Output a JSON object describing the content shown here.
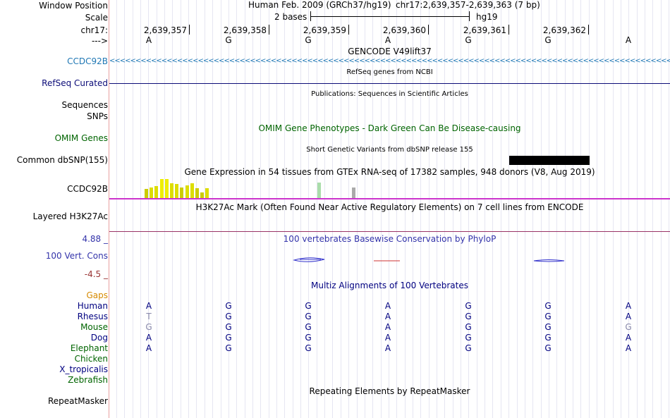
{
  "labels": {
    "window_position": "Window Position",
    "scale": "Scale",
    "chrom": "chr17:",
    "strand": "--->",
    "ccdc92b_gencode": "CCDC92B",
    "refseq": "RefSeq Curated",
    "sequences": "Sequences",
    "snps": "SNPs",
    "omim": "OMIM Genes",
    "dbsnp": "Common dbSNP(155)",
    "gtex": "CCDC92B",
    "h3k27ac": "Layered H3K27Ac",
    "cons_max": "4.88 _",
    "cons_name": "100 Vert. Cons",
    "cons_min": "-4.5 _",
    "gaps": "Gaps",
    "repeatmasker": "RepeatMasker"
  },
  "header": {
    "assembly": "Human Feb. 2009 (GRCh37/hg19)",
    "position": "chr17:2,639,357-2,639,363 (7 bp)",
    "scale_text": "2 bases",
    "scale_db": "hg19"
  },
  "ruler": {
    "positions": [
      "2,639,357",
      "2,639,358",
      "2,639,359",
      "2,639,360",
      "2,639,361",
      "2,639,362"
    ],
    "bases": [
      "A",
      "G",
      "G",
      "A",
      "G",
      "G",
      "A"
    ]
  },
  "track_titles": {
    "gencode": "GENCODE V49lift37",
    "refseq": "RefSeq genes from NCBI",
    "publications": "Publications: Sequences in Scientific Articles",
    "omim": "OMIM Gene Phenotypes - Dark Green Can Be Disease-causing",
    "dbsnp": "Short Genetic Variants from dbSNP release 155",
    "gtex": "Gene Expression in 54 tissues from GTEx RNA-seq of 17382 samples, 948 donors (V8, Aug 2019)",
    "h3k27ac": "H3K27Ac Mark (Often Found Near Active Regulatory Elements) on 7 cell lines from ENCODE",
    "conservation": "100 vertebrates Basewise Conservation by PhyloP",
    "multiz": "Multiz Alignments of 100 Vertebrates",
    "repeatmasker": "Repeating Elements by RepeatMasker"
  },
  "gtex_bars": {
    "values": [
      0.45,
      0.55,
      0.6,
      0.95,
      0.95,
      0.75,
      0.7,
      0.55,
      0.65,
      0.75,
      0.5,
      0.3,
      0.5
    ],
    "colors": [
      "#cccc00",
      "#dddd00",
      "#dddd00",
      "#eeee00",
      "#eeee00",
      "#dddd00",
      "#dddd00",
      "#cccc00",
      "#dddd00",
      "#dddd00",
      "#cccc00",
      "#cccc00",
      "#dddd00"
    ],
    "extra": [
      {
        "value": 0.8,
        "color": "#aaddaa"
      },
      {
        "value": 0.55,
        "color": "#aaaaaa"
      }
    ]
  },
  "multiz": {
    "species": [
      {
        "name": "Human",
        "color": "#000080",
        "bases": [
          "A",
          "G",
          "G",
          "A",
          "G",
          "G",
          "A"
        ],
        "faded": [
          false,
          false,
          false,
          false,
          false,
          false,
          false
        ]
      },
      {
        "name": "Rhesus",
        "color": "#000080",
        "bases": [
          "T",
          "G",
          "G",
          "A",
          "G",
          "G",
          "A"
        ],
        "faded": [
          true,
          false,
          false,
          false,
          false,
          false,
          false
        ]
      },
      {
        "name": "Mouse",
        "color": "#006400",
        "bases": [
          "G",
          "G",
          "G",
          "A",
          "G",
          "G",
          "G"
        ],
        "faded": [
          true,
          false,
          false,
          false,
          false,
          false,
          true
        ]
      },
      {
        "name": "Dog",
        "color": "#000080",
        "bases": [
          "A",
          "G",
          "G",
          "A",
          "G",
          "G",
          "A"
        ],
        "faded": [
          false,
          false,
          false,
          false,
          false,
          false,
          false
        ]
      },
      {
        "name": "Elephant",
        "color": "#006400",
        "bases": [
          "A",
          "G",
          "G",
          "A",
          "G",
          "G",
          "A"
        ],
        "faded": [
          false,
          false,
          false,
          false,
          false,
          false,
          false
        ]
      },
      {
        "name": "Chicken",
        "color": "#006400",
        "bases": [],
        "faded": []
      },
      {
        "name": "X_tropicalis",
        "color": "#000080",
        "bases": [],
        "faded": []
      },
      {
        "name": "Zebrafish",
        "color": "#006400",
        "bases": [],
        "faded": []
      }
    ]
  },
  "colors": {
    "gencode": "#1f77b4",
    "refseq": "#0c0c78",
    "omim": "#006400",
    "conservation": "#3333aa",
    "cons_neg": "#993333",
    "gaps": "#d68a00",
    "gtex_line": "#cc33cc",
    "h3k27ac_line": "#993366"
  }
}
